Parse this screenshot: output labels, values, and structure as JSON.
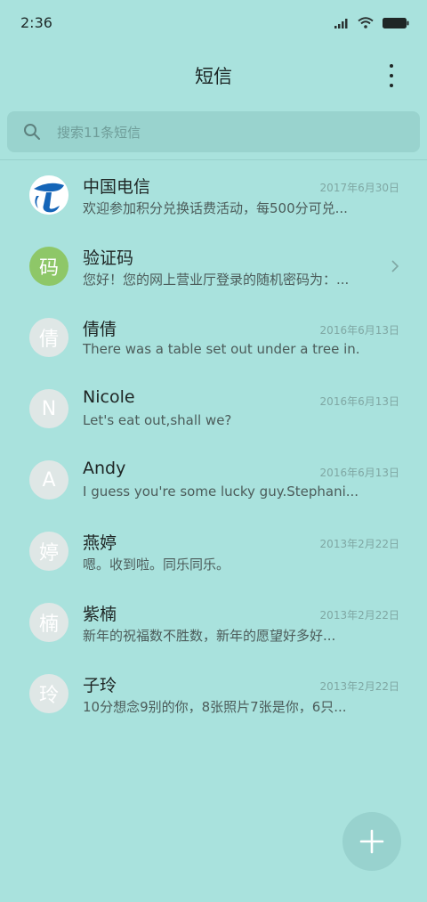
{
  "status_bar": {
    "time": "2:36"
  },
  "header": {
    "title": "短信"
  },
  "search": {
    "placeholder": "搜索11条短信"
  },
  "conversations": [
    {
      "name": "中国电信",
      "preview": "欢迎参加积分兑换话费活动，每500分可兑...",
      "date": "2017年6月30日",
      "avatar": "",
      "avatar_icon": "china-telecom-logo"
    },
    {
      "name": "验证码",
      "preview": "您好！您的网上营业厅登录的随机密码为：...",
      "date": "",
      "avatar": "码",
      "avatar_color": "#8ec768"
    },
    {
      "name": "倩倩",
      "preview": "There was a table set out under a tree in...",
      "date": "2016年6月13日",
      "avatar": "倩"
    },
    {
      "name": "Nicole",
      "preview": "Let's eat out,shall we?",
      "date": "2016年6月13日",
      "avatar": "N"
    },
    {
      "name": "Andy",
      "preview": "I guess you're some lucky guy.Stephani...",
      "date": "2016年6月13日",
      "avatar": "A"
    },
    {
      "name": "燕婷",
      "preview": "嗯。收到啦。同乐同乐。",
      "date": "2013年2月22日",
      "avatar": "婷"
    },
    {
      "name": "紫楠",
      "preview": "新年的祝福数不胜数，新年的愿望好多好...",
      "date": "2013年2月22日",
      "avatar": "楠"
    },
    {
      "name": "子玲",
      "preview": "10分想念9别的你，8张照片7张是你，6只...",
      "date": "2013年2月22日",
      "avatar": "玲"
    }
  ],
  "colors": {
    "background": "#a9e2dd",
    "search_background": "#99d3ce",
    "avatar_default": "#dfe7e6",
    "telecom_blue": "#1565b8"
  }
}
